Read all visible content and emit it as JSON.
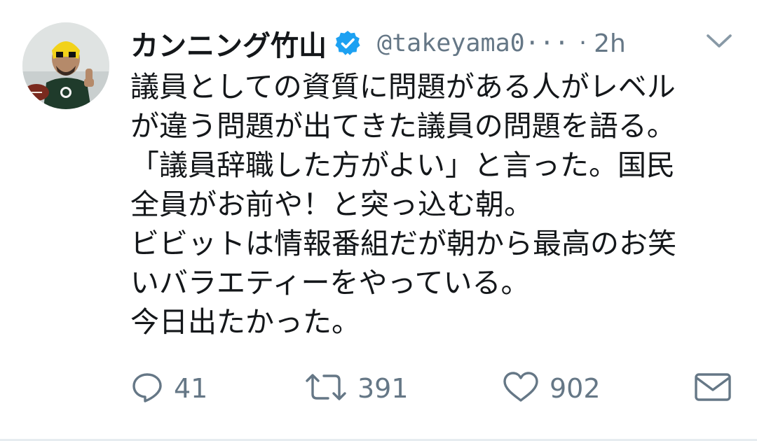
{
  "tweet": {
    "display_name": "カンニング竹山",
    "handle": "@takeyama0···",
    "separator": "·",
    "time": "2h",
    "lines": [
      "議員としての資質に問題がある人がレベル",
      "が違う問題が出てきた議員の問題を語る。",
      "「議員辞職した方がよい」と言った。国民",
      "全員がお前や！と突っ込む朝。",
      "ビビットは情報番組だが朝から最高のお笑",
      "いバラエティーをやっている。",
      "今日出たかった。"
    ],
    "actions": {
      "replies": "41",
      "retweets": "391",
      "likes": "902"
    }
  },
  "colors": {
    "text": "#14171a",
    "secondary": "#657786",
    "verified_blue": "#1da1f2",
    "divider": "#e6ecf0"
  },
  "icons": {
    "verified": "verified-badge-icon",
    "caret": "chevron-down-icon",
    "reply": "reply-icon",
    "retweet": "retweet-icon",
    "like": "heart-icon",
    "dm": "envelope-icon"
  }
}
